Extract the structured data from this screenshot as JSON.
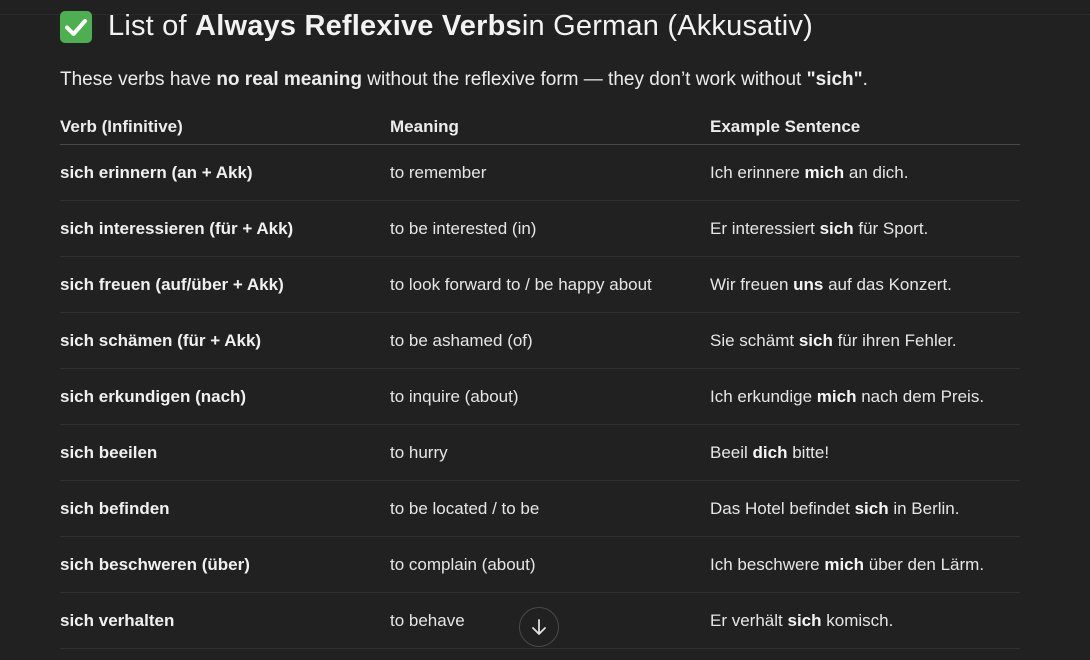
{
  "heading": {
    "icon": "check-mark-button-icon",
    "pre": "List of ",
    "bold": "Always Reflexive Verbs",
    "post": " in German (Akkusativ)"
  },
  "intro": {
    "pre": "These verbs have ",
    "bold1": "no real meaning",
    "mid": " without the reflexive form — they don’t work without ",
    "quote_open": "\"",
    "bold2": "sich",
    "quote_close": "\"",
    "end": "."
  },
  "table": {
    "headers": [
      "Verb (Infinitive)",
      "Meaning",
      "Example Sentence"
    ],
    "rows": [
      {
        "verb": "sich erinnern (an + Akk)",
        "meaning": "to remember",
        "ex_pre": "Ich erinnere ",
        "ex_bold": "mich",
        "ex_post": " an dich."
      },
      {
        "verb": "sich interessieren (für + Akk)",
        "meaning": "to be interested (in)",
        "ex_pre": "Er interessiert ",
        "ex_bold": "sich",
        "ex_post": " für Sport."
      },
      {
        "verb": "sich freuen (auf/über + Akk)",
        "meaning": "to look forward to / be happy about",
        "ex_pre": "Wir freuen ",
        "ex_bold": "uns",
        "ex_post": " auf das Konzert."
      },
      {
        "verb": "sich schämen (für + Akk)",
        "meaning": "to be ashamed (of)",
        "ex_pre": "Sie schämt ",
        "ex_bold": "sich",
        "ex_post": " für ihren Fehler."
      },
      {
        "verb": "sich erkundigen (nach)",
        "meaning": "to inquire (about)",
        "ex_pre": "Ich erkundige ",
        "ex_bold": "mich",
        "ex_post": " nach dem Preis."
      },
      {
        "verb": "sich beeilen",
        "meaning": "to hurry",
        "ex_pre": "Beeil ",
        "ex_bold": "dich",
        "ex_post": " bitte!"
      },
      {
        "verb": "sich befinden",
        "meaning": "to be located / to be",
        "ex_pre": "Das Hotel befindet ",
        "ex_bold": "sich",
        "ex_post": " in Berlin."
      },
      {
        "verb": "sich beschweren (über)",
        "meaning": "to complain (about)",
        "ex_pre": "Ich beschwere ",
        "ex_bold": "mich",
        "ex_post": " über den Lärm."
      },
      {
        "verb": "sich verhalten",
        "meaning": "to behave",
        "ex_pre": "Er verhält ",
        "ex_bold": "sich",
        "ex_post": " komisch."
      }
    ]
  },
  "scroll_button": {
    "icon": "arrow-down-icon"
  },
  "colors": {
    "background": "#212121",
    "text": "#ececec",
    "check": "#4caf50"
  }
}
